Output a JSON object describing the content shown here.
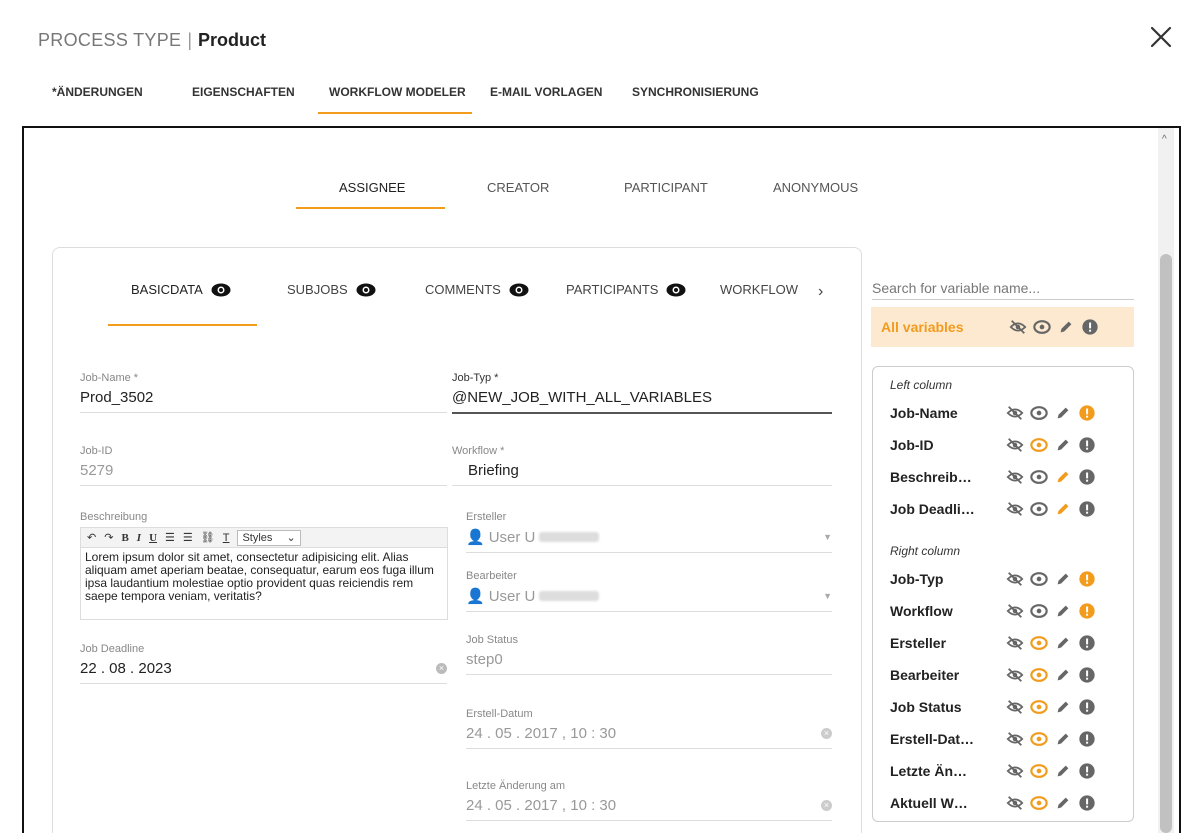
{
  "header": {
    "process_type": "PROCESS TYPE",
    "separator": "|",
    "name": "Product"
  },
  "top_tabs": [
    "*ÄNDERUNGEN",
    "EIGENSCHAFTEN",
    "WORKFLOW MODELER",
    "E-MAIL VORLAGEN",
    "SYNCHRONISIERUNG"
  ],
  "active_top_tab": "WORKFLOW MODELER",
  "role_tabs": [
    "ASSIGNEE",
    "CREATOR",
    "PARTICIPANT",
    "ANONYMOUS"
  ],
  "active_role_tab": "ASSIGNEE",
  "sub_tabs": [
    "BASICDATA",
    "SUBJOBS",
    "COMMENTS",
    "PARTICIPANTS",
    "WORKFLOW"
  ],
  "active_sub_tab": "BASICDATA",
  "form": {
    "job_name": {
      "label": "Job-Name *",
      "value": "Prod_3502"
    },
    "job_typ": {
      "label": "Job-Typ *",
      "value": "@NEW_JOB_WITH_ALL_VARIABLES"
    },
    "job_id": {
      "label": "Job-ID",
      "value": "5279"
    },
    "workflow": {
      "label": "Workflow *",
      "value": "Briefing"
    },
    "beschreibung": {
      "label": "Beschreibung",
      "styles_label": "Styles",
      "text": "Lorem ipsum dolor sit amet, consectetur adipisicing elit. Alias aliquam amet aperiam beatae, consequatur, earum eos fuga illum ipsa laudantium molestiae optio provident quas reiciendis rem saepe tempora veniam, veritatis?"
    },
    "ersteller": {
      "label": "Ersteller",
      "value": "User U"
    },
    "bearbeiter": {
      "label": "Bearbeiter",
      "value": "User U"
    },
    "job_deadline": {
      "label": "Job Deadline",
      "value": "22 . 08 . 2023"
    },
    "job_status": {
      "label": "Job Status",
      "value": "step0"
    },
    "erstell_datum": {
      "label": "Erstell-Datum",
      "value": "24 . 05 . 2017 ,  10 : 30"
    },
    "letzte_aenderung": {
      "label": "Letzte Änderung am",
      "value": "24 . 05 . 2017 ,  10 : 30"
    }
  },
  "variables_panel": {
    "search_placeholder": "Search for variable name...",
    "all_variables_label": "All variables",
    "left_column_title": "Left column",
    "right_column_title": "Right column",
    "active_color": "#f29b1d",
    "inactive_color": "#666666",
    "left_rows": [
      {
        "name": "Job-Name",
        "active": "required"
      },
      {
        "name": "Job-ID",
        "active": "visible"
      },
      {
        "name": "Beschreib…",
        "active": "editable"
      },
      {
        "name": "Job Deadli…",
        "active": "editable"
      }
    ],
    "right_rows": [
      {
        "name": "Job-Typ",
        "active": "required"
      },
      {
        "name": "Workflow",
        "active": "required"
      },
      {
        "name": "Ersteller",
        "active": "visible"
      },
      {
        "name": "Bearbeiter",
        "active": "visible"
      },
      {
        "name": "Job Status",
        "active": "visible"
      },
      {
        "name": "Erstell-Dat…",
        "active": "visible"
      },
      {
        "name": "Letzte Än…",
        "active": "visible"
      },
      {
        "name": "Aktuell W…",
        "active": "visible"
      }
    ]
  }
}
